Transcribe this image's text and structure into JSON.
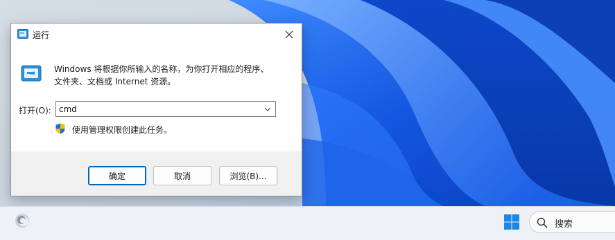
{
  "dialog": {
    "title": "运行",
    "description_line1": "Windows 将根据你所输入的名称，为你打开相应的程序、",
    "description_line2": "文件夹、文档或 Internet 资源。",
    "open_label": "打开(O):",
    "open_value": "cmd",
    "admin_note": "使用管理权限创建此任务。",
    "buttons": {
      "ok": "确定",
      "cancel": "取消",
      "browse": "浏览(B)..."
    }
  },
  "taskbar": {
    "search_label": "搜索"
  },
  "colors": {
    "accent": "#0067c0",
    "wallpaper_blue": "#1a5fe0"
  }
}
